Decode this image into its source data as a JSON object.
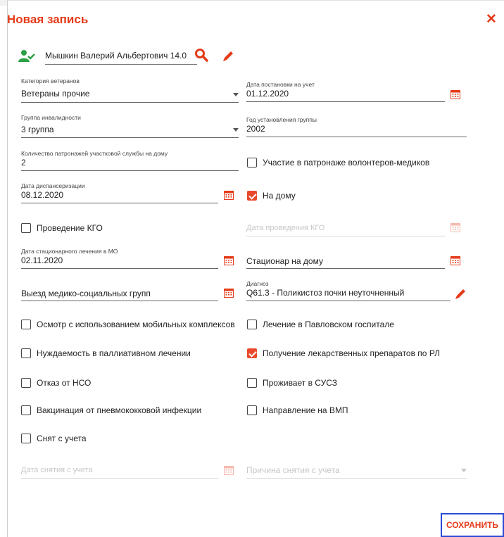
{
  "dialog": {
    "title": "Новая запись",
    "close_icon": "close-icon"
  },
  "person": {
    "name": "Мышкин Валерий Альбертович  14.0"
  },
  "fields": {
    "veteran_category": {
      "label": "Категория ветеранов",
      "value": "Ветераны прочие"
    },
    "registration_date": {
      "label": "Дата постановки на учет",
      "value": "01.12.2020"
    },
    "disability_group": {
      "label": "Группа инвалидности",
      "value": "3 группа"
    },
    "group_year": {
      "label": "Год установления группы",
      "value": "2002"
    },
    "home_visits": {
      "label": "Количество патронажей участковой службы на дому",
      "value": "2"
    },
    "dispensary_date": {
      "label": "Дата диспансеризации",
      "value": "08.12.2020"
    },
    "kgo_date": {
      "placeholder": "Дата проведения КГО"
    },
    "hospital_date": {
      "label": "Дата стационарного лечения в МО",
      "value": "02.11.2020"
    },
    "home_hospital": {
      "placeholder": "Стационар на дому"
    },
    "medsocial_groups": {
      "placeholder": "Выезд медико-социальных групп"
    },
    "diagnosis": {
      "label": "Диагноз",
      "value": "Q61.3 - Поликистоз почки неуточненный"
    },
    "deregistration_date": {
      "placeholder": "Дата снятия с учета"
    },
    "deregistration_reason": {
      "placeholder": "Причина снятия с учета"
    }
  },
  "checkboxes": {
    "volunteer_patronage": {
      "label": "Участие в патронаже волонтеров-медиков",
      "checked": false
    },
    "at_home": {
      "label": "На дому",
      "checked": true
    },
    "kgo": {
      "label": "Проведение КГО",
      "checked": false
    },
    "mobile_exam": {
      "label": "Осмотр с использованием мобильных комплексов",
      "checked": false
    },
    "pavlovsky": {
      "label": "Лечение в Павловском госпитале",
      "checked": false
    },
    "palliative": {
      "label": "Нуждаемость в паллиативном лечении",
      "checked": false
    },
    "drugs_rl": {
      "label": "Получение лекарственных препаратов по РЛ",
      "checked": true
    },
    "nso_refusal": {
      "label": "Отказ от НСО",
      "checked": false
    },
    "susz": {
      "label": "Проживает в СУСЗ",
      "checked": false
    },
    "pneumo": {
      "label": "Вакцинация от пневмококковой инфекции",
      "checked": false
    },
    "vmp": {
      "label": "Направление на ВМП",
      "checked": false
    },
    "deregistered": {
      "label": "Снят с учета",
      "checked": false
    }
  },
  "footer": {
    "save_label": "СОХРАНИТЬ"
  },
  "colors": {
    "accent": "#e53b19",
    "check_fill": "#e8492a",
    "person_icon": "#2aa043",
    "save_border": "#2c4bd6"
  }
}
